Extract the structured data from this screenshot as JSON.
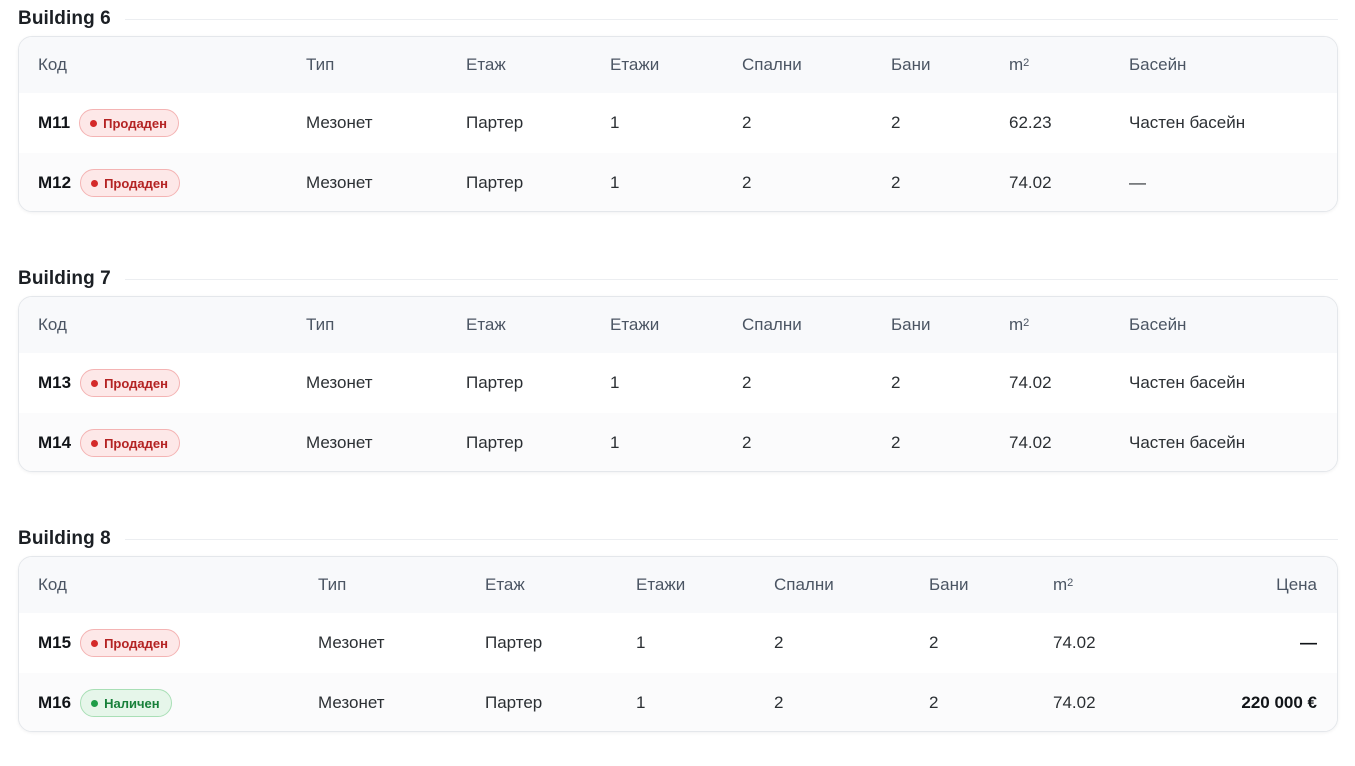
{
  "buildings": [
    {
      "title": "Building 6",
      "headers": {
        "code": "Код",
        "type": "Тип",
        "floor": "Етаж",
        "floors": "Етажи",
        "bedrooms": "Спални",
        "baths": "Бани",
        "area_base": "m",
        "area_sup": "2",
        "last": "Басейн"
      },
      "rows": [
        {
          "code": "M11",
          "status": "Продаден",
          "status_kind": "sold",
          "type": "Мезонет",
          "floor": "Партер",
          "floors": "1",
          "bedrooms": "2",
          "baths": "2",
          "area": "62.23",
          "last": "Частен басейн"
        },
        {
          "code": "M12",
          "status": "Продаден",
          "status_kind": "sold",
          "type": "Мезонет",
          "floor": "Партер",
          "floors": "1",
          "bedrooms": "2",
          "baths": "2",
          "area": "74.02",
          "last": "—"
        }
      ]
    },
    {
      "title": "Building 7",
      "headers": {
        "code": "Код",
        "type": "Тип",
        "floor": "Етаж",
        "floors": "Етажи",
        "bedrooms": "Спални",
        "baths": "Бани",
        "area_base": "m",
        "area_sup": "2",
        "last": "Басейн"
      },
      "rows": [
        {
          "code": "M13",
          "status": "Продаден",
          "status_kind": "sold",
          "type": "Мезонет",
          "floor": "Партер",
          "floors": "1",
          "bedrooms": "2",
          "baths": "2",
          "area": "74.02",
          "last": "Частен басейн"
        },
        {
          "code": "M14",
          "status": "Продаден",
          "status_kind": "sold",
          "type": "Мезонет",
          "floor": "Партер",
          "floors": "1",
          "bedrooms": "2",
          "baths": "2",
          "area": "74.02",
          "last": "Частен басейн"
        }
      ]
    },
    {
      "title": "Building 8",
      "headers": {
        "code": "Код",
        "type": "Тип",
        "floor": "Етаж",
        "floors": "Етажи",
        "bedrooms": "Спални",
        "baths": "Бани",
        "area_base": "m",
        "area_sup": "2",
        "last": "Цена"
      },
      "rows": [
        {
          "code": "M15",
          "status": "Продаден",
          "status_kind": "sold",
          "type": "Мезонет",
          "floor": "Партер",
          "floors": "1",
          "bedrooms": "2",
          "baths": "2",
          "area": "74.02",
          "last": "—"
        },
        {
          "code": "M16",
          "status": "Наличен",
          "status_kind": "available",
          "type": "Мезонет",
          "floor": "Партер",
          "floors": "1",
          "bedrooms": "2",
          "baths": "2",
          "area": "74.02",
          "last": "220 000 €"
        }
      ]
    }
  ],
  "colors": {
    "sold": "#d42a2a",
    "available": "#1f9d48"
  }
}
